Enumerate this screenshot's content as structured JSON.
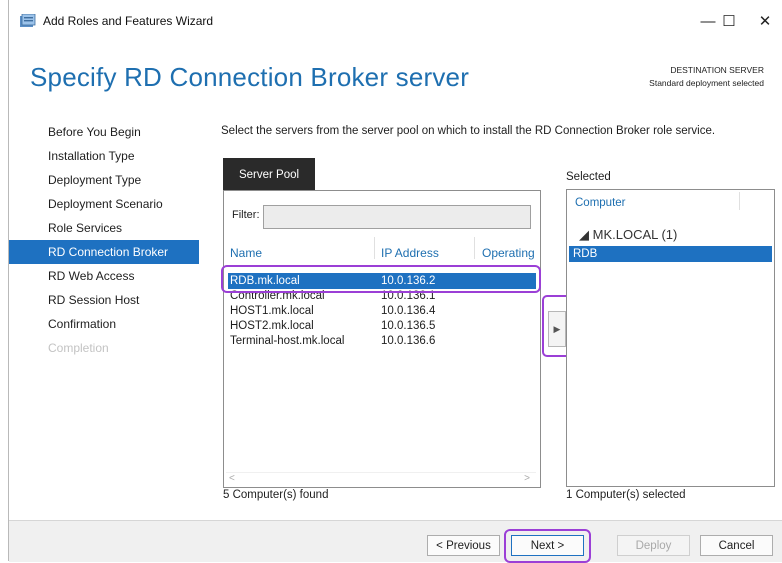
{
  "window": {
    "title": "Add Roles and Features Wizard",
    "minimize": "—",
    "maximize": "☐",
    "close": "✕"
  },
  "page": {
    "heading": "Specify RD Connection Broker server",
    "destination_label": "DESTINATION SERVER",
    "destination_value": "Standard deployment selected",
    "instruction": "Select the servers from the server pool on which to install the RD Connection Broker role service."
  },
  "nav": {
    "items": [
      {
        "label": "Before You Begin",
        "state": "normal"
      },
      {
        "label": "Installation Type",
        "state": "normal"
      },
      {
        "label": "Deployment Type",
        "state": "normal"
      },
      {
        "label": "Deployment Scenario",
        "state": "normal"
      },
      {
        "label": "Role Services",
        "state": "normal"
      },
      {
        "label": "RD Connection Broker",
        "state": "active"
      },
      {
        "label": "RD Web Access",
        "state": "normal"
      },
      {
        "label": "RD Session Host",
        "state": "normal"
      },
      {
        "label": "Confirmation",
        "state": "normal"
      },
      {
        "label": "Completion",
        "state": "disabled"
      }
    ]
  },
  "server_pool": {
    "tab_label": "Server Pool",
    "filter_label": "Filter:",
    "filter_value": "",
    "columns": {
      "name": "Name",
      "ip": "IP Address",
      "os": "Operating"
    },
    "rows": [
      {
        "name": "RDB.mk.local",
        "ip": "10.0.136.2",
        "selected": true
      },
      {
        "name": "Controller.mk.local",
        "ip": "10.0.136.1",
        "selected": false
      },
      {
        "name": "HOST1.mk.local",
        "ip": "10.0.136.4",
        "selected": false
      },
      {
        "name": "HOST2.mk.local",
        "ip": "10.0.136.5",
        "selected": false
      },
      {
        "name": "Terminal-host.mk.local",
        "ip": "10.0.136.6",
        "selected": false
      }
    ],
    "found_text": "5 Computer(s) found",
    "scroll_left": "<",
    "scroll_right": ">"
  },
  "add_button": {
    "glyph": "▶"
  },
  "selected_panel": {
    "label": "Selected",
    "column": "Computer",
    "group": "◢  MK.LOCAL (1)",
    "rows": [
      "RDB"
    ],
    "count_text": "1 Computer(s) selected"
  },
  "footer": {
    "previous": "< Previous",
    "next": "Next >",
    "deploy": "Deploy",
    "cancel": "Cancel"
  },
  "colors": {
    "accent": "#1e71c1",
    "heading": "#1e6fb0",
    "highlight_annotation": "#9b3fd6"
  }
}
